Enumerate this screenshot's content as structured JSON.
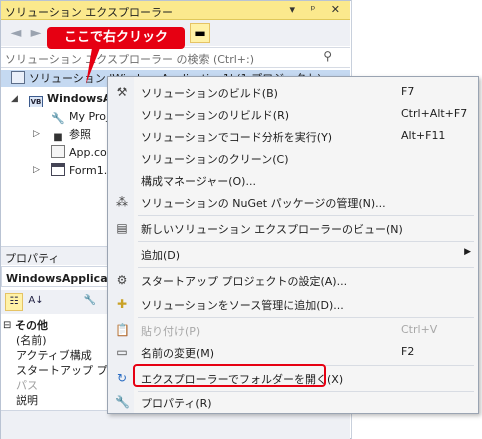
{
  "solution_explorer": {
    "title": "ソリューション エクスプローラー",
    "title_buttons": "▾ ᵖ ✕",
    "search_placeholder": "ソリューション エクスプローラー の検索 (Ctrl+:)",
    "tree": {
      "solution": "ソリューション 'WindowsApplication1' (1 プロジェクト)",
      "project": "WindowsApplication1",
      "my_project": "My Project",
      "references": "参照",
      "app_config": "App.config",
      "form1": "Form1.vb"
    }
  },
  "properties": {
    "title": "プロパティ",
    "object": "WindowsApplication1 プロジェクトのプロパティ",
    "category": "その他",
    "rows": [
      "(名前)",
      "アクティブ構成",
      "スタートアップ プロジェクト",
      "パス",
      "説明"
    ]
  },
  "context_menu": {
    "items": [
      {
        "label": "ソリューションのビルド(B)",
        "shortcut": "F7",
        "icon": "build-icon"
      },
      {
        "label": "ソリューションのリビルド(R)",
        "shortcut": "Ctrl+Alt+F7",
        "icon": ""
      },
      {
        "label": "ソリューションでコード分析を実行(Y)",
        "shortcut": "Alt+F11",
        "icon": ""
      },
      {
        "label": "ソリューションのクリーン(C)",
        "shortcut": "",
        "icon": ""
      },
      {
        "label": "構成マネージャー(O)...",
        "shortcut": "",
        "icon": ""
      },
      {
        "label": "ソリューションの NuGet パッケージの管理(N)...",
        "shortcut": "",
        "icon": "nuget-icon"
      },
      {
        "label": "新しいソリューション エクスプローラーのビュー(N)",
        "shortcut": "",
        "icon": "new-view-icon"
      },
      {
        "label": "追加(D)",
        "shortcut": "",
        "icon": ""
      },
      {
        "label": "スタートアップ プロジェクトの設定(A)...",
        "shortcut": "",
        "icon": "gear-icon"
      },
      {
        "label": "ソリューションをソース管理に追加(D)...",
        "shortcut": "",
        "icon": "source-control-icon"
      },
      {
        "label": "貼り付け(P)",
        "shortcut": "Ctrl+V",
        "icon": "paste-icon"
      },
      {
        "label": "名前の変更(M)",
        "shortcut": "F2",
        "icon": "rename-icon"
      },
      {
        "label": "エクスプローラーでフォルダーを開く(X)",
        "shortcut": "",
        "icon": "refresh-icon"
      },
      {
        "label": "プロパティ(R)",
        "shortcut": "",
        "icon": "wrench-icon"
      }
    ]
  },
  "callout": {
    "text": "ここで右クリック",
    "color": "#e60012"
  },
  "colors": {
    "title_bar": "#fbe98d",
    "selection": "#c5d9f1",
    "highlight_border": "#e60012"
  }
}
